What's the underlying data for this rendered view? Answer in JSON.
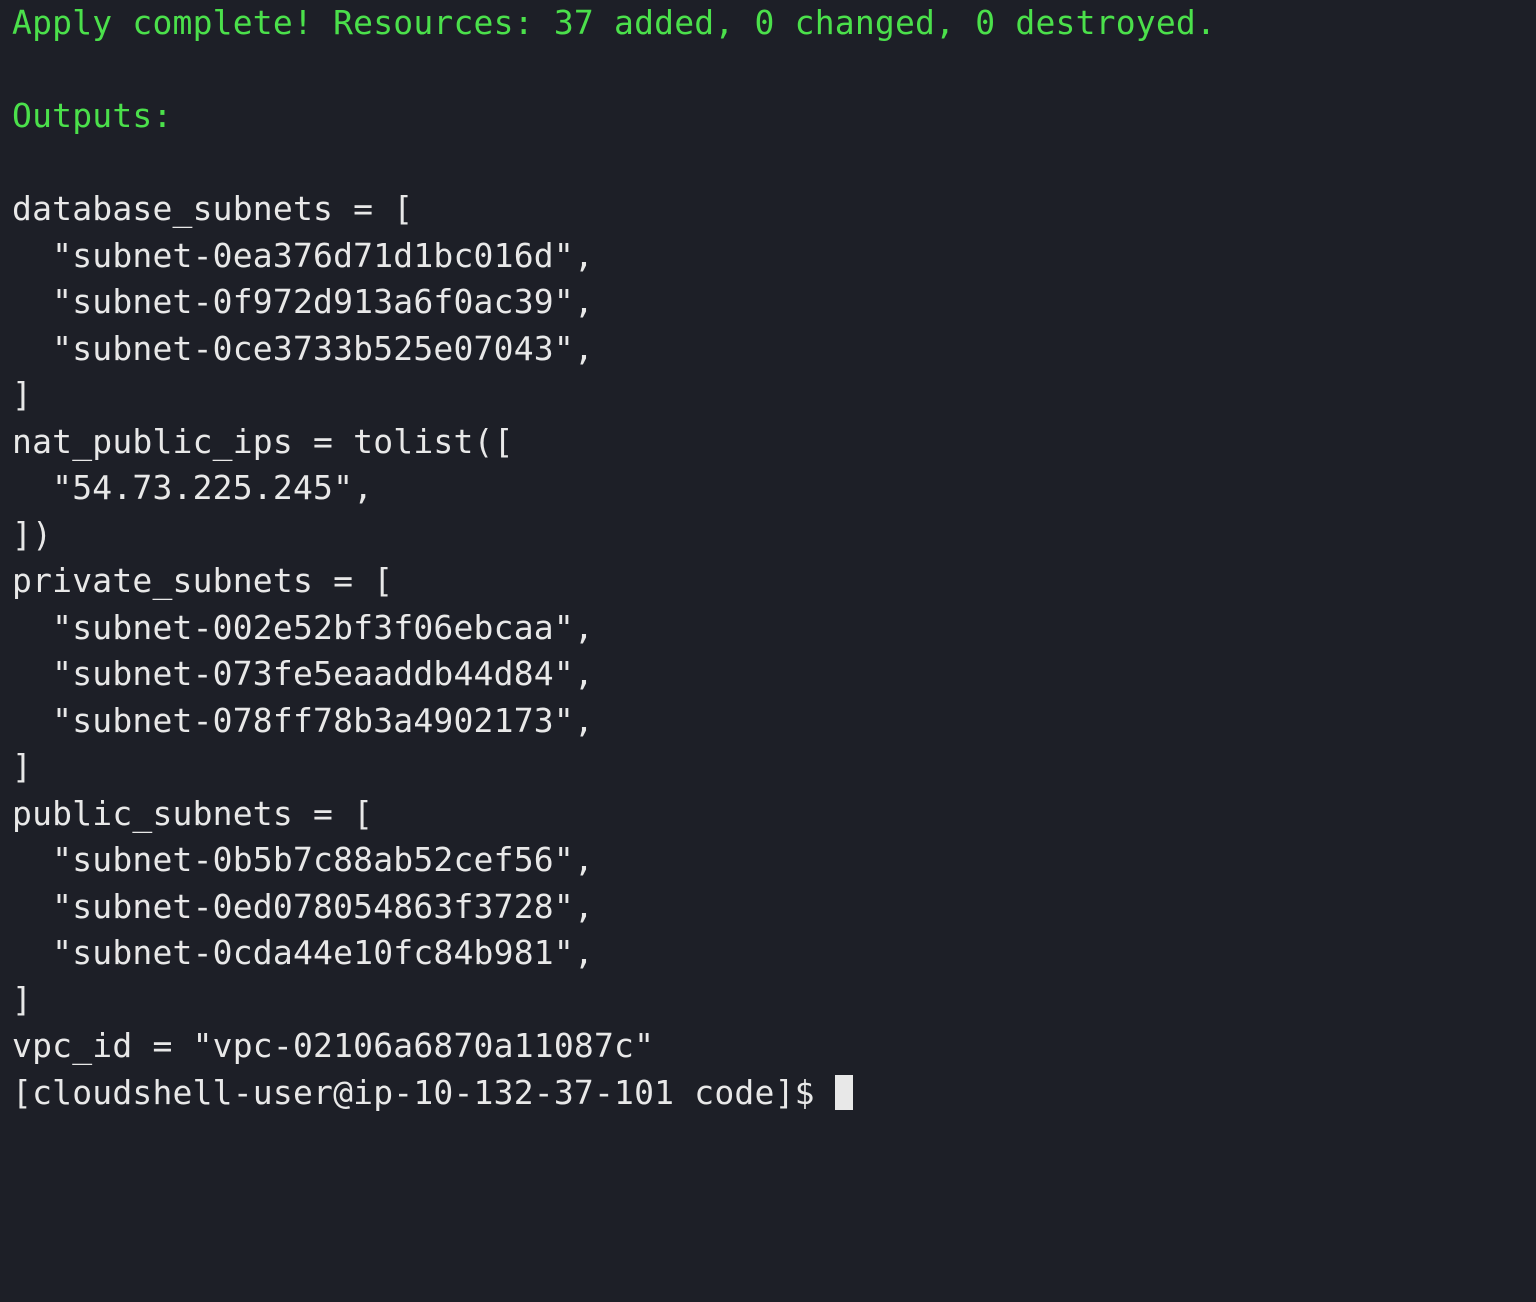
{
  "summary_line": "Apply complete! Resources: 37 added, 0 changed, 0 destroyed.",
  "outputs_header": "Outputs:",
  "outputs": {
    "database_subnets": {
      "open": "database_subnets = [",
      "items": [
        "  \"subnet-0ea376d71d1bc016d\",",
        "  \"subnet-0f972d913a6f0ac39\",",
        "  \"subnet-0ce3733b525e07043\","
      ],
      "close": "]"
    },
    "nat_public_ips": {
      "open": "nat_public_ips = tolist([",
      "items": [
        "  \"54.73.225.245\","
      ],
      "close": "])"
    },
    "private_subnets": {
      "open": "private_subnets = [",
      "items": [
        "  \"subnet-002e52bf3f06ebcaa\",",
        "  \"subnet-073fe5eaaddb44d84\",",
        "  \"subnet-078ff78b3a4902173\","
      ],
      "close": "]"
    },
    "public_subnets": {
      "open": "public_subnets = [",
      "items": [
        "  \"subnet-0b5b7c88ab52cef56\",",
        "  \"subnet-0ed078054863f3728\",",
        "  \"subnet-0cda44e10fc84b981\","
      ],
      "close": "]"
    },
    "vpc_id_line": "vpc_id = \"vpc-02106a6870a11087c\""
  },
  "prompt": "[cloudshell-user@ip-10-132-37-101 code]$ "
}
